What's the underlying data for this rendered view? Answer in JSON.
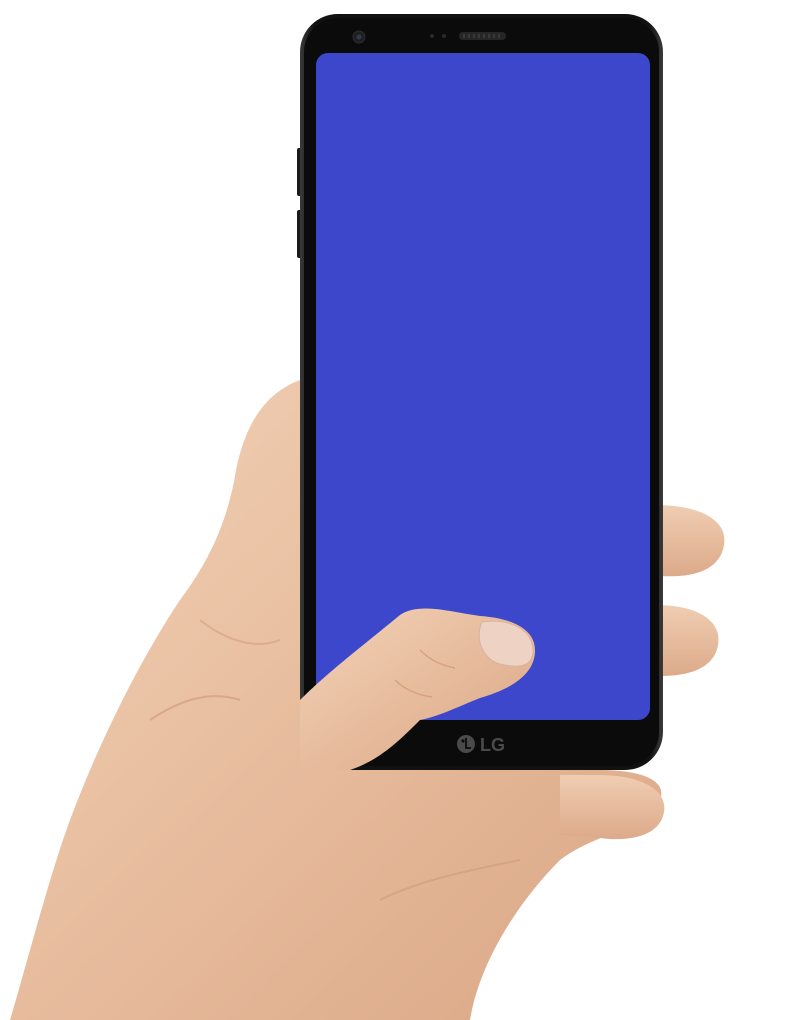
{
  "scene": {
    "background_color": "#ffffff",
    "phone": {
      "brand_text": "LG",
      "body_color": "#0e0e0e",
      "screen_color": "#3d47cb"
    },
    "hand": {
      "skin_color": "#e8c0a2"
    }
  }
}
